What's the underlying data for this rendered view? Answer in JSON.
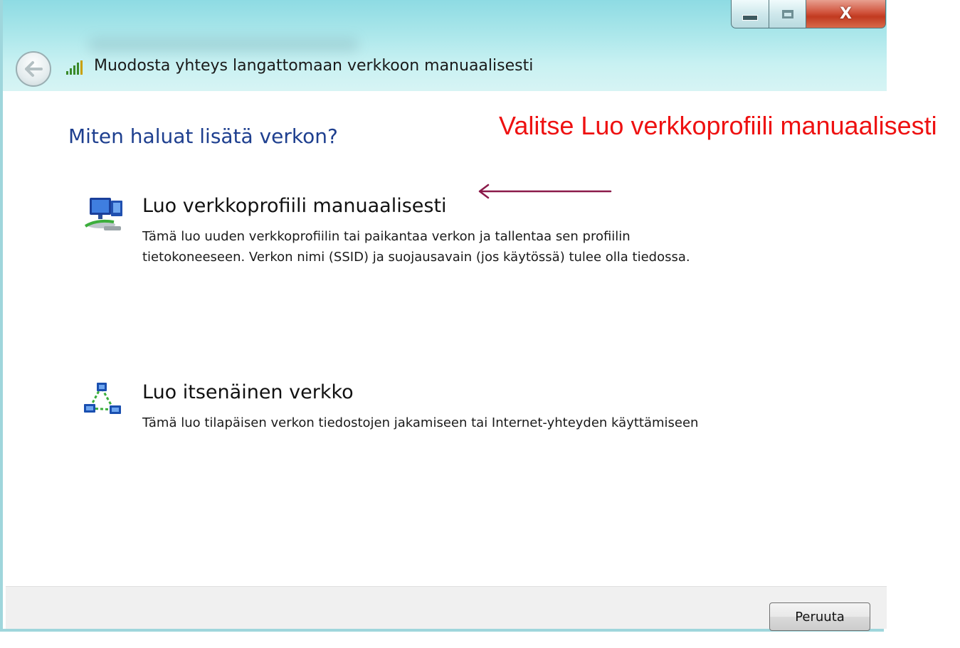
{
  "window": {
    "title": "Muodosta yhteys langattomaan verkkoon manuaalisesti",
    "controls": {
      "minimize_icon": "minimize-icon",
      "maximize_icon": "maximize-icon",
      "close_glyph": "X"
    }
  },
  "main": {
    "question": "Miten haluat lisätä verkon?",
    "options": [
      {
        "title": "Luo verkkoprofiili manuaalisesti",
        "description": "Tämä luo uuden verkkoprofiilin tai paikantaa verkon ja tallentaa sen profiilin tietokoneeseen. Verkon nimi (SSID) ja suojausavain (jos käytössä) tulee olla tiedossa.",
        "icon": "network-computers-icon"
      },
      {
        "title": "Luo itsenäinen verkko",
        "description": "Tämä luo tilapäisen verkon tiedostojen jakamiseen tai Internet-yhteyden käyttämiseen",
        "icon": "adhoc-network-icon"
      }
    ]
  },
  "footer": {
    "cancel_label": "Peruuta"
  },
  "annotation": {
    "text": "Valitse Luo verkkoprofiili manuaalisesti"
  },
  "colors": {
    "title_bar": "#a9e6ea",
    "question_text": "#1e3f8f",
    "annotation_text": "#ee1111",
    "annotation_arrow": "#8b1a4a",
    "close_button": "#c13a20"
  }
}
